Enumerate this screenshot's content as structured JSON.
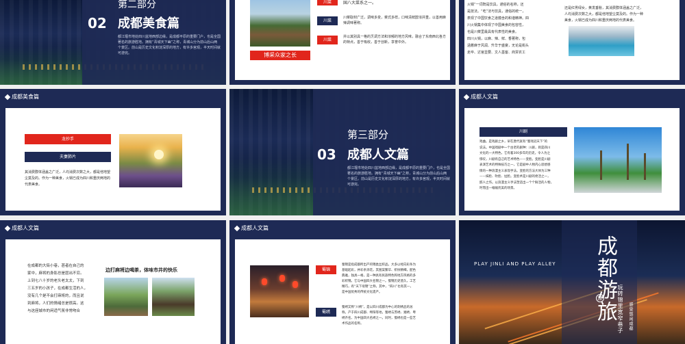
{
  "slides": {
    "s1": {
      "part": "第二部分",
      "number": "02",
      "title": "成都美食篇",
      "body": "都江堰市地处四川盆地西部边缘，是成都平原的重要门户，也是全国著名的旅游胜地。拥有“青城天下幽”之称，青城山分为前山后山两个景区。前山是历史文化积淀深厚的地方，有许多宫观，半天时间就可游完。"
    },
    "s2": {
      "tags": [
        "川菜",
        "川菜",
        "川菜"
      ],
      "texts": [
        "国八大菜系之一。",
        "川菜取材广泛，调味多变，菜式多样，口味清鲜醇浓并重，以善用麻辣调味著称。",
        "并以其别具一格的烹调方法和浓郁的地方风味，融合了东南西北各方的特点，善于吸收，善于创新，享誉中外。"
      ],
      "banner": "博采众家之长"
    },
    "s3": {
      "lines": [
        "火锅”一词既是饮具，通俗的名称，还",
        "是技法。“吃”法与饮具，通俗的统一，",
        "表现了中国饮食之道蕴含的和谐精神。四",
        "川火锅集中体现了中国美食的包容性，",
        "也是川菜里最具有代表性的美食。",
        "四川火锅，以麻、辣、鲜、香著称，包",
        "涵着麻于风润、升华于盛宴，无论是街头",
        "走卒、达官显要、文人墨客、商贾农工"
      ],
      "right": [
        "还是红男绿女，黄发垂髫，其消费群体涵盖之广泛，",
        "人均消费次数之大，都是他地望尘莫及的。作为一种",
        "美食，火锅已成为四川和重庆两地的代表美食。"
      ]
    },
    "s4": {
      "header": "成都美食篇",
      "tag1": "龙抄手",
      "tag2": "夫妻肺片",
      "body": "其消费群体涵盖之广泛，人均消费次数之大，都是他地望尘莫及的。作为一种美食，火锅已成为四川和重庆两地的代表美食。"
    },
    "s5": {
      "part": "第三部分",
      "number": "03",
      "title": "成都人文篇",
      "body": "都江堰市地处四川盆地西部边缘，是成都平原的重要门户，也是全国著名的旅游胜地。拥有“青城天下幽”之称，青城山分为前山后山两个景区。前山是历史文化积淀深厚的地方，有许多宫观，半天时间就可游完。"
    },
    "s6": {
      "header": "成都人文篇",
      "heading": "川剧",
      "lines": [
        "戏曲。是戏剧之乡，早在唐代就有“蜀戏冠天下”的",
        "说法。中国戏剧中一个古老的剧种：川剧，则是四川",
        "文化的一大特色，它有着300多年的历史。令人为之",
        "惊叹，川剧有自己的艺术特色——变脸。变脸是川剧",
        "表演艺术的特殊技巧之一，它是剧中人物内心思想感",
        "情的一种浪漫主义表现手法。变脸的方法大体为三种",
        "——抹脸、吹脸、扯脸。变脸术是川剧的绝活之一，",
        "醉人之作。以浪漫主义手法塑造出一个个鲜活的人物，",
        "时而出一幅幅优美的场景。"
      ]
    },
    "s7": {
      "header": "成都人文篇",
      "lines": [
        "在成都的大街小巷，甚者在自己的",
        "家中，麻将的身影总是层出不穷。",
        "上到七八十岁的老头老太太，下到",
        "三五岁的小孩子，在成都生活的人，",
        "没有几个是不会打麻将的，而且说",
        "到麻将，人们的情绪总是很高。这",
        "与这座城市的闲适气氛非常吻合"
      ],
      "quote": "边打麻将边喝茶，体味市井的快乐"
    },
    "s8": {
      "header": "成都人文篇",
      "tag1": "蜀锦",
      "tag2": "蜀绣",
      "text1": [
        "蜀锦是指成都所出产的锦类丝织品。大多以经向彩条为",
        "基础起彩，并彩条添花，其图案繁华、织纹精细，配色",
        "典雅，独具一格，是一种具有民族特色和地方风格的多",
        "彩织锦。它与中国四大名锦之一。蜀锦历史悠久，工艺",
        "精巧，有“天下母锦”之称，其中，“四川”也有其一，",
        "是中国优秀的传统文化遗产。"
      ],
      "text2": [
        "蜀绣又称“川绣”，是以四川成都为中心的刺绣品的总",
        "称。产于四川成都、绵阳等地，蜀绣与苏绣、湘绣、粤",
        "绣齐名，为中国四大名绣之一。同时，蜀绣也是一些艺",
        "术作品的名称。"
      ]
    },
    "s9": {
      "title_chars": "成都游旅",
      "subtitle": "PLAY JINLI AND PLAY ALLEY",
      "side1": "玩转锦里宽窄巷子",
      "side2": "感受悠闲成都",
      "circle": "旅"
    }
  }
}
